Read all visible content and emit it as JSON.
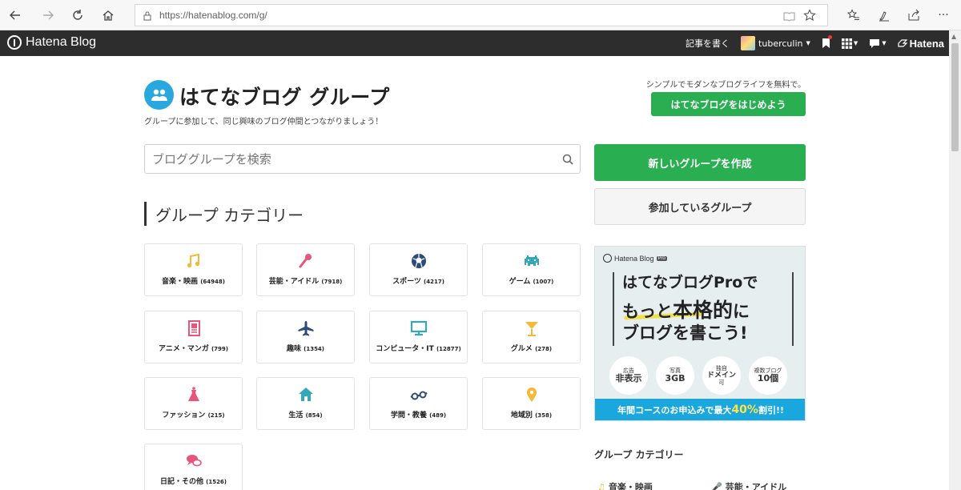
{
  "browser": {
    "url": "https://hatenablog.com/g/"
  },
  "topbar": {
    "logo": "Hatena Blog",
    "write": "記事を書く",
    "username": "tuberculin",
    "hatena": "Hatena"
  },
  "header": {
    "title": "はてなブログ グループ",
    "subtitle": "グループに参加して、同じ興味のブログ仲間とつながりましょう！",
    "promo": "シンプルでモダンなブログライフを無料で。",
    "start_button": "はてなブログをはじめよう"
  },
  "search": {
    "placeholder": "ブロググループを検索"
  },
  "categories_title": "グループ カテゴリー",
  "categories": [
    {
      "label": "音楽・映画",
      "count": "(64948)",
      "icon": "music-note-icon",
      "color": "#f5b93a"
    },
    {
      "label": "芸能・アイドル",
      "count": "(7918)",
      "icon": "microphone-icon",
      "color": "#e8547a"
    },
    {
      "label": "スポーツ",
      "count": "(4217)",
      "icon": "soccer-ball-icon",
      "color": "#2e4a7a"
    },
    {
      "label": "ゲーム",
      "count": "(1007)",
      "icon": "space-invader-icon",
      "color": "#35a8b8"
    },
    {
      "label": "アニメ・マンガ",
      "count": "(799)",
      "icon": "comic-book-icon",
      "color": "#e8547a"
    },
    {
      "label": "趣味",
      "count": "(1354)",
      "icon": "airplane-icon",
      "color": "#2e4a7a"
    },
    {
      "label": "コンピュータ・IT",
      "count": "(12877)",
      "icon": "computer-monitor-icon",
      "color": "#35a8b8"
    },
    {
      "label": "グルメ",
      "count": "(278)",
      "icon": "cocktail-glass-icon",
      "color": "#f5b93a"
    },
    {
      "label": "ファッション",
      "count": "(215)",
      "icon": "dress-icon",
      "color": "#e8547a"
    },
    {
      "label": "生活",
      "count": "(854)",
      "icon": "house-icon",
      "color": "#35a8b8"
    },
    {
      "label": "学問・教養",
      "count": "(489)",
      "icon": "glasses-icon",
      "color": "#2e4a7a"
    },
    {
      "label": "地域別",
      "count": "(358)",
      "icon": "map-pin-icon",
      "color": "#f5b93a"
    },
    {
      "label": "日記・その他",
      "count": "(1526)",
      "icon": "speech-bubbles-icon",
      "color": "#e8547a"
    }
  ],
  "sidebar": {
    "create_button": "新しいグループを作成",
    "joined_button": "参加しているグループ",
    "ad": {
      "logo": "Hatena Blog",
      "pro_tag": "Pro",
      "line1": "はてなブログProで",
      "line2a": "もっと",
      "line2b": "本格的",
      "line2c": "に",
      "line3": "ブログを書こう!",
      "badges": [
        {
          "top": "広告",
          "bottom": "非表示",
          "sub": ""
        },
        {
          "top": "写真",
          "bottom": "3GB",
          "sub": ""
        },
        {
          "top": "独自",
          "bottom": "ドメイン",
          "sub": "可"
        },
        {
          "top": "複数ブログ",
          "bottom": "10個",
          "sub": ""
        }
      ],
      "footer_a": "年間コースのお申込みで最大",
      "footer_big": "40%",
      "footer_b": "割引!!"
    },
    "category_title": "グループ カテゴリー",
    "category_items": [
      "音楽・映画",
      "芸能・アイドル"
    ]
  },
  "colors": {
    "green": "#2aae52",
    "blue": "#29a8e0",
    "dark_bar": "#2d2d2d"
  }
}
